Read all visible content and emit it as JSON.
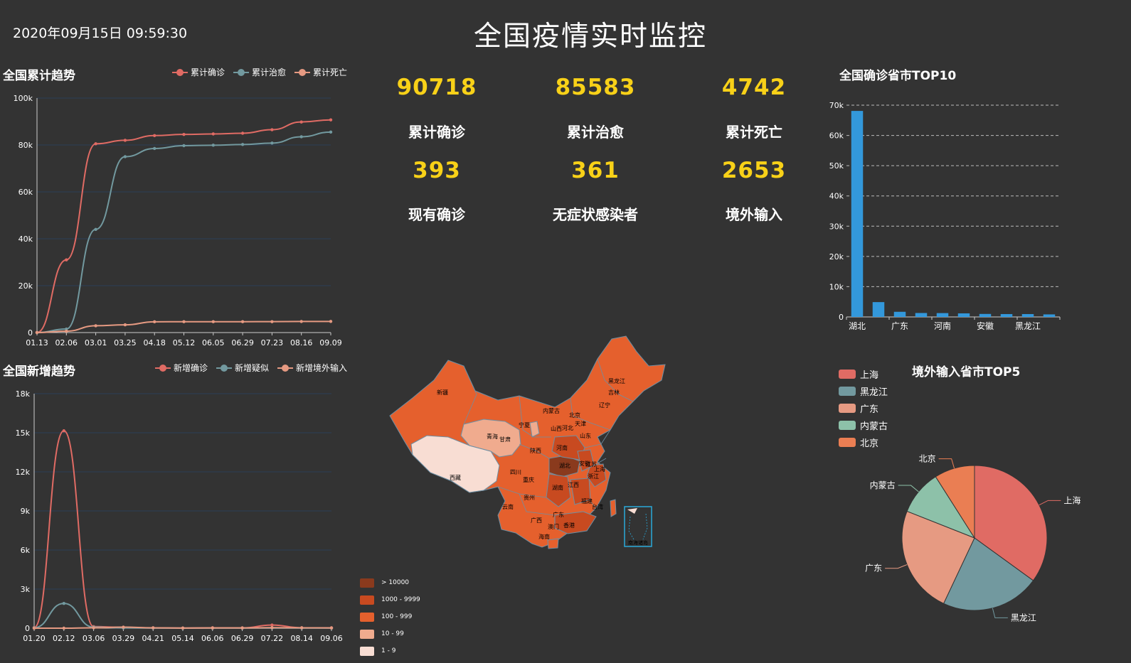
{
  "header": {
    "datetime": "2020年09月15日 09:59:30",
    "title": "全国疫情实时监控"
  },
  "kpis": [
    {
      "value": "90718",
      "label": "累计确诊"
    },
    {
      "value": "85583",
      "label": "累计治愈"
    },
    {
      "value": "4742",
      "label": "累计死亡"
    },
    {
      "value": "393",
      "label": "现有确诊"
    },
    {
      "value": "361",
      "label": "无症状感染者"
    },
    {
      "value": "2653",
      "label": "境外输入"
    }
  ],
  "colors": {
    "confirmed": "#e06b64",
    "cured": "#72999f",
    "dead": "#e69a82",
    "suspected": "#72999f",
    "imported": "#e69a82",
    "bar": "#3398db",
    "kpi": "#f8d118"
  },
  "chart_data": [
    {
      "type": "line",
      "title": "全国累计趋势",
      "categories": [
        "01.13",
        "02.06",
        "03.01",
        "03.25",
        "04.18",
        "05.12",
        "06.05",
        "06.29",
        "07.23",
        "08.16",
        "09.09"
      ],
      "yticks": [
        "0",
        "20k",
        "40k",
        "60k",
        "80k",
        "100k"
      ],
      "ylim": [
        0,
        100000
      ],
      "series": [
        {
          "name": "累计确诊",
          "color": "#e06b64",
          "values": [
            41,
            31000,
            80500,
            82000,
            84000,
            84500,
            84700,
            85000,
            86500,
            89800,
            90700
          ]
        },
        {
          "name": "累计治愈",
          "color": "#72999f",
          "values": [
            0,
            1500,
            44000,
            75000,
            78500,
            79700,
            79900,
            80200,
            80800,
            83500,
            85500
          ]
        },
        {
          "name": "累计死亡",
          "color": "#e69a82",
          "values": [
            1,
            600,
            2900,
            3300,
            4600,
            4640,
            4640,
            4640,
            4650,
            4720,
            4742
          ]
        }
      ],
      "legend": "top-right"
    },
    {
      "type": "line",
      "title": "全国新增趋势",
      "categories": [
        "01.20",
        "02.12",
        "03.06",
        "03.29",
        "04.21",
        "05.14",
        "06.06",
        "06.29",
        "07.22",
        "08.14",
        "09.06"
      ],
      "yticks": [
        "0",
        "3k",
        "6k",
        "9k",
        "12k",
        "15k",
        "18k"
      ],
      "ylim": [
        0,
        18000
      ],
      "series": [
        {
          "name": "新增确诊",
          "color": "#e06b64",
          "values": [
            50,
            15150,
            120,
            60,
            20,
            10,
            30,
            20,
            240,
            30,
            30
          ]
        },
        {
          "name": "新增疑似",
          "color": "#72999f",
          "values": [
            30,
            1900,
            80,
            20,
            10,
            5,
            5,
            5,
            10,
            5,
            5
          ]
        },
        {
          "name": "新增境外输入",
          "color": "#e69a82",
          "values": [
            0,
            0,
            30,
            80,
            30,
            10,
            20,
            20,
            40,
            30,
            20
          ]
        }
      ],
      "legend": "top-right"
    },
    {
      "type": "bar",
      "title": "全国确诊省市TOP10",
      "categories": [
        "湖北",
        "",
        "广东",
        "",
        "河南",
        "",
        "安徽",
        "",
        "黑龙江",
        ""
      ],
      "values": [
        68100,
        4900,
        1700,
        1300,
        1270,
        1180,
        991,
        948,
        947,
        839
      ],
      "yticks": [
        "0",
        "10k",
        "20k",
        "30k",
        "40k",
        "50k",
        "60k",
        "70k"
      ],
      "ylim": [
        0,
        70000
      ],
      "grid": true
    },
    {
      "type": "pie",
      "title": "境外输入省市TOP5",
      "slices": [
        {
          "name": "上海",
          "value": 35,
          "color": "#e06b64"
        },
        {
          "name": "黑龙江",
          "value": 22,
          "color": "#72999f"
        },
        {
          "name": "广东",
          "value": 24,
          "color": "#e69a82"
        },
        {
          "name": "内蒙古",
          "value": 10,
          "color": "#8dc1a9"
        },
        {
          "name": "北京",
          "value": 9,
          "color": "#ea7e53"
        }
      ],
      "legend": "top-left"
    }
  ],
  "map": {
    "inset_label": "南海诸岛",
    "legend": [
      {
        "label": "> 10000",
        "color": "#8a3a1d"
      },
      {
        "label": "1000 - 9999",
        "color": "#c84a20"
      },
      {
        "label": "100 - 999",
        "color": "#e5602d"
      },
      {
        "label": "10 - 99",
        "color": "#f0ab8e"
      },
      {
        "label": "1 - 9",
        "color": "#f8ddd3"
      }
    ],
    "labels": [
      "新疆",
      "西藏",
      "青海",
      "甘肃",
      "宁夏",
      "内蒙古",
      "黑龙江",
      "吉林",
      "辽宁",
      "北京",
      "天津",
      "河北",
      "山西",
      "山东",
      "陕西",
      "河南",
      "四川",
      "重庆",
      "湖北",
      "安徽",
      "江苏",
      "上海",
      "浙江",
      "湖南",
      "江西",
      "福建",
      "台湾",
      "贵州",
      "云南",
      "广西",
      "广东",
      "香港",
      "澳门",
      "海南"
    ]
  }
}
